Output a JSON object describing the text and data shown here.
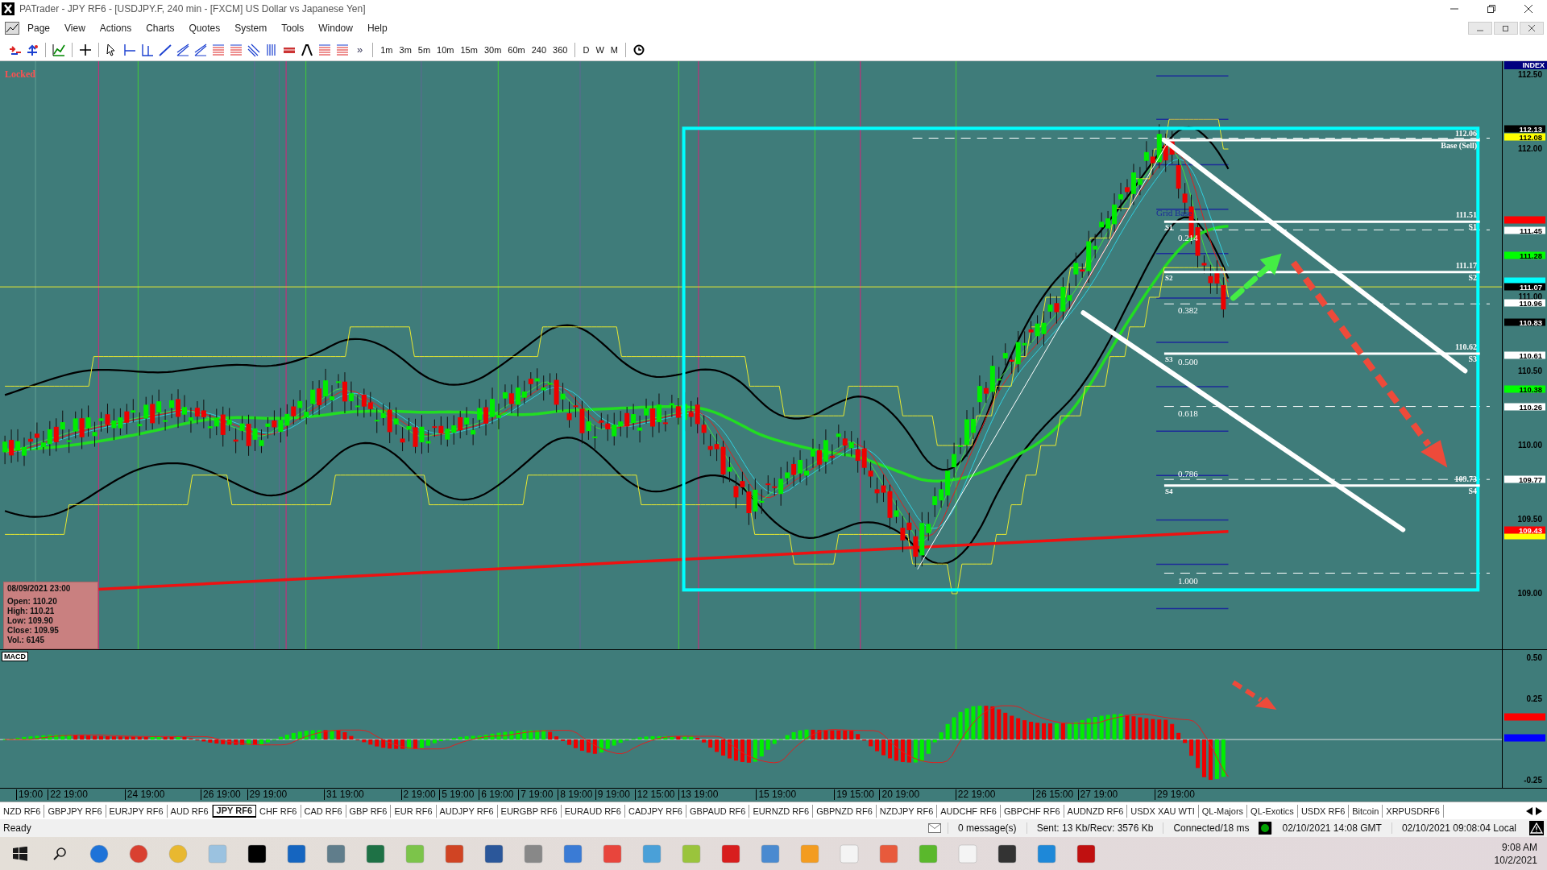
{
  "window": {
    "title": "PATrader - JPY RF6 - [USDJPY.F, 240 min - [FXCM] US Dollar vs Japanese Yen]"
  },
  "menu": [
    "Page",
    "View",
    "Actions",
    "Charts",
    "Quotes",
    "System",
    "Tools",
    "Window",
    "Help"
  ],
  "toolbar": {
    "overflow": "»",
    "timeframes": [
      "1m",
      "3m",
      "5m",
      "10m",
      "15m",
      "30m",
      "60m",
      "240",
      "360"
    ],
    "periods": [
      "D",
      "W",
      "M"
    ]
  },
  "chart": {
    "status": "Locked",
    "index_label": "INDEX",
    "price_ticks": [
      "112.50",
      "112.00",
      "111.00",
      "110.50",
      "110.00",
      "109.50",
      "109.00"
    ],
    "price_tags": [
      {
        "text": "112.13",
        "color": "#000000"
      },
      {
        "text": "112.08",
        "color": "#ffff00"
      },
      {
        "color": "#ff0000"
      },
      {
        "text": "111.45",
        "color": "#ffffff"
      },
      {
        "text": "111.28",
        "color": "#00ff00"
      },
      {
        "color": "#00ffff"
      },
      {
        "text": "111.07",
        "color": "#000000"
      },
      {
        "text": "110.96",
        "color": "#ffffff"
      },
      {
        "text": "110.83",
        "color": "#000000"
      },
      {
        "text": "110.61",
        "color": "#ffffff"
      },
      {
        "text": "110.38",
        "color": "#00ff00"
      },
      {
        "text": "110.26",
        "color": "#ffffff"
      },
      {
        "text": "109.77",
        "color": "#ffffff"
      },
      {
        "text": "109.43",
        "color": "#ff0000"
      },
      {
        "color": "#ffff00"
      }
    ],
    "grid_label": "Grid Base",
    "fib_labels": [
      "0.214",
      "0.382",
      "0.500",
      "0.618",
      "0.786",
      "1.000"
    ],
    "levels": [
      {
        "price": "112.06",
        "label": "Base (Sell)"
      },
      {
        "price": "111.51",
        "label": "S1",
        "left_label": "S1"
      },
      {
        "price": "111.17",
        "label": "S2",
        "left_label": "S2"
      },
      {
        "price": "110.62",
        "label": "S3",
        "left_label": "S3"
      },
      {
        "price": "109.73",
        "label": "S4",
        "left_label": "S4"
      }
    ],
    "info": {
      "date": "08/09/2021 23:00",
      "lines": [
        "Open: 110.20",
        "High: 110.21",
        "Low: 109.90",
        "Close: 109.95",
        "Vol.: 6145"
      ]
    }
  },
  "macd": {
    "label": "MACD",
    "ticks": [
      "0.50",
      "0.25",
      "-0.25"
    ],
    "tags": [
      {
        "color": "#ff0000"
      },
      {
        "color": "#0000ff"
      }
    ]
  },
  "time_axis": [
    "19:00",
    "22 19:00",
    "24 19:00",
    "26 19:00",
    "29 19:00",
    "31 19:00",
    "2 19:00",
    "5 19:00",
    "6 19:00",
    "7 19:00",
    "8 19:00",
    "9 19:00",
    "12 15:00",
    "13 19:00",
    "15 19:00",
    "19 15:00",
    "20 19:00",
    "22 19:00",
    "26 15:00",
    "27 19:00",
    "29 19:00"
  ],
  "tabs": [
    {
      "label": "NZD RF6",
      "selected": false
    },
    {
      "label": "GBPJPY RF6",
      "selected": false
    },
    {
      "label": "EURJPY RF6",
      "selected": false
    },
    {
      "label": "AUD RF6",
      "selected": false
    },
    {
      "label": "JPY RF6",
      "selected": true
    },
    {
      "label": "CHF RF6",
      "selected": false
    },
    {
      "label": "CAD RF6",
      "selected": false
    },
    {
      "label": "GBP RF6",
      "selected": false
    },
    {
      "label": "EUR RF6",
      "selected": false
    },
    {
      "label": "AUDJPY RF6",
      "selected": false
    },
    {
      "label": "EURGBP RF6",
      "selected": false
    },
    {
      "label": "EURAUD RF6",
      "selected": false
    },
    {
      "label": "CADJPY RF6",
      "selected": false
    },
    {
      "label": "GBPAUD RF6",
      "selected": false
    },
    {
      "label": "EURNZD RF6",
      "selected": false
    },
    {
      "label": "GBPNZD RF6",
      "selected": false
    },
    {
      "label": "NZDJPY RF6",
      "selected": false
    },
    {
      "label": "AUDCHF RF6",
      "selected": false
    },
    {
      "label": "GBPCHF RF6",
      "selected": false
    },
    {
      "label": "AUDNZD RF6",
      "selected": false
    },
    {
      "label": "USDX XAU WTI",
      "selected": false
    },
    {
      "label": "QL-Majors",
      "selected": false
    },
    {
      "label": "QL-Exotics",
      "selected": false
    },
    {
      "label": "USDX RF6",
      "selected": false
    },
    {
      "label": "Bitcoin",
      "selected": false
    },
    {
      "label": "XRPUSDRF6",
      "selected": false
    }
  ],
  "status_bar": {
    "state": "Ready",
    "messages": "0 message(s)",
    "traffic": "Sent: 13 Kb/Recv: 3576 Kb",
    "connection": "Connected/18 ms",
    "gmt": "02/10/2021 14:08 GMT",
    "local": "02/10/2021 09:08:04 Local"
  },
  "taskbar": {
    "time": "9:08 AM",
    "date": "10/2/2021"
  }
}
